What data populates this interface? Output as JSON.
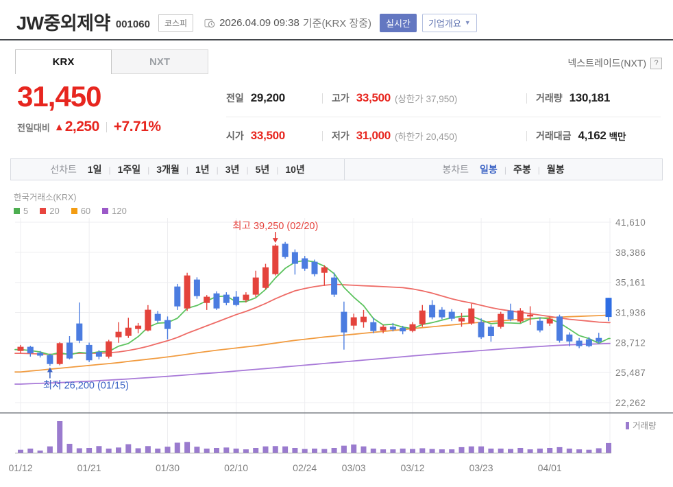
{
  "header": {
    "title": "JW중외제약",
    "code": "001060",
    "market_badge": "코스피",
    "datetime": "2026.04.09 09:38",
    "datetime_suffix": "기준(KRX 장중)",
    "realtime_badge": "실시간",
    "company_overview": "기업개요",
    "nxt_label": "넥스트레이드(NXT)",
    "help": "?"
  },
  "tabs": {
    "krx": "KRX",
    "nxt": "NXT"
  },
  "price": {
    "current": "31,450",
    "change_label": "전일대비",
    "arrow": "▲",
    "change": "2,250",
    "percent": "+7.71%"
  },
  "info": {
    "rows": [
      {
        "cells": [
          {
            "label": "전일",
            "value": "29,200",
            "color": "dark"
          },
          {
            "label": "고가",
            "value": "33,500",
            "color": "red",
            "extra": "(상한가 37,950)"
          },
          {
            "label": "거래량",
            "value": "130,181",
            "color": "dark"
          }
        ]
      },
      {
        "cells": [
          {
            "label": "시가",
            "value": "33,500",
            "color": "red"
          },
          {
            "label": "저가",
            "value": "31,000",
            "color": "red",
            "extra": "(하한가 20,450)"
          },
          {
            "label": "거래대금",
            "value": "4,162",
            "color": "dark",
            "unit": "백만"
          }
        ]
      }
    ]
  },
  "toolbar": {
    "line_label": "선차트",
    "ranges": [
      "1일",
      "1주일",
      "3개월",
      "1년",
      "3년",
      "5년",
      "10년"
    ],
    "candle_label": "봉차트",
    "candle_types": [
      "일봉",
      "주봉",
      "월봉"
    ],
    "selected_candle": "일봉"
  },
  "chart_data": {
    "type": "candlestick+volume",
    "source_label": "한국거래소(KRX)",
    "ma_legend": [
      {
        "period": "5",
        "color": "#4cae50"
      },
      {
        "period": "20",
        "color": "#e8453e"
      },
      {
        "period": "60",
        "color": "#f39c12"
      },
      {
        "period": "120",
        "color": "#9b59c8"
      }
    ],
    "y_ticks": [
      {
        "v": 41610,
        "label": "41,610"
      },
      {
        "v": 38386,
        "label": "38,386"
      },
      {
        "v": 35161,
        "label": "35,161"
      },
      {
        "v": 31936,
        "label": "31,936"
      },
      {
        "v": 28712,
        "label": "28,712"
      },
      {
        "v": 25487,
        "label": "25,487"
      },
      {
        "v": 22262,
        "label": "22,262"
      }
    ],
    "x_ticks": [
      {
        "label": "01/12",
        "index": 0
      },
      {
        "label": "01/21",
        "index": 7
      },
      {
        "label": "01/30",
        "index": 15
      },
      {
        "label": "02/10",
        "index": 22
      },
      {
        "label": "02/24",
        "index": 29
      },
      {
        "label": "03/03",
        "index": 34
      },
      {
        "label": "03/12",
        "index": 40
      },
      {
        "label": "03/23",
        "index": 47
      },
      {
        "label": "04/01",
        "index": 54
      }
    ],
    "annotations": {
      "high": {
        "text": "최고 39,250 (02/20)",
        "index": 26,
        "value": 39250,
        "color": "#e5413c"
      },
      "low": {
        "text": "최저 26,200 (01/15)",
        "index": 3,
        "value": 26200,
        "color": "#3a62c4"
      }
    },
    "volume_legend": "거래량",
    "current_index": 60,
    "colors": {
      "up": "#e4433c",
      "down": "#4b7ce0",
      "current": "#2e6de3",
      "volume": "#9a7bce",
      "grid": "#ededf0",
      "axis_text": "#7f7f7f",
      "ma5": "#5cc35e",
      "ma20": "#ee6b66",
      "ma60": "#f19b3f",
      "ma120": "#a879d8"
    },
    "candles": [
      [
        27800,
        28450,
        27550,
        28250
      ],
      [
        28250,
        28350,
        27200,
        27550
      ],
      [
        27600,
        27800,
        27100,
        27300
      ],
      [
        27350,
        27500,
        26200,
        26400
      ],
      [
        26400,
        28750,
        26270,
        28640
      ],
      [
        28700,
        29400,
        26900,
        27000
      ],
      [
        30750,
        33000,
        28650,
        28900
      ],
      [
        28450,
        28700,
        26600,
        26800
      ],
      [
        27700,
        27900,
        26900,
        27200
      ],
      [
        27200,
        29000,
        27000,
        28830
      ],
      [
        29270,
        30890,
        28680,
        29860
      ],
      [
        29420,
        31360,
        29200,
        30300
      ],
      [
        30150,
        30800,
        29700,
        30520
      ],
      [
        30000,
        32720,
        29900,
        32220
      ],
      [
        31780,
        32100,
        30800,
        31040
      ],
      [
        31110,
        31500,
        29050,
        30160
      ],
      [
        34720,
        35000,
        32200,
        32585
      ],
      [
        32360,
        36190,
        32100,
        35900
      ],
      [
        35460,
        35700,
        33400,
        33690
      ],
      [
        32950,
        33800,
        32200,
        33620
      ],
      [
        33980,
        34200,
        32200,
        32360
      ],
      [
        33840,
        34100,
        32700,
        32950
      ],
      [
        33620,
        34240,
        32600,
        32730
      ],
      [
        33250,
        34100,
        33000,
        33840
      ],
      [
        33840,
        36410,
        33600,
        35680
      ],
      [
        34570,
        37150,
        34400,
        36780
      ],
      [
        36040,
        39250,
        35900,
        39100
      ],
      [
        39300,
        39500,
        37700,
        37880
      ],
      [
        38400,
        38700,
        36000,
        37150
      ],
      [
        37740,
        38000,
        36400,
        36630
      ],
      [
        37370,
        37600,
        35800,
        36040
      ],
      [
        36190,
        37000,
        34790,
        36780
      ],
      [
        35680,
        36200,
        33600,
        33840
      ],
      [
        32000,
        33100,
        27950,
        29790
      ],
      [
        30520,
        31800,
        30100,
        31410
      ],
      [
        30890,
        32200,
        30300,
        31480
      ],
      [
        30890,
        31400,
        29700,
        29940
      ],
      [
        30000,
        30600,
        29700,
        30400
      ],
      [
        30400,
        30800,
        29900,
        30100
      ],
      [
        30300,
        30500,
        29600,
        29900
      ],
      [
        29950,
        30900,
        29800,
        30670
      ],
      [
        30670,
        32730,
        30400,
        32140
      ],
      [
        32730,
        33250,
        31200,
        31410
      ],
      [
        32220,
        32500,
        31200,
        31410
      ],
      [
        32000,
        32300,
        31000,
        31260
      ],
      [
        30970,
        31900,
        30400,
        31330
      ],
      [
        30750,
        32880,
        30600,
        32360
      ],
      [
        30890,
        31300,
        29100,
        29270
      ],
      [
        30400,
        30600,
        28800,
        29400
      ],
      [
        30380,
        32000,
        30200,
        31780
      ],
      [
        32140,
        32880,
        31000,
        31190
      ],
      [
        30970,
        32400,
        30800,
        32140
      ],
      [
        31500,
        32600,
        30600,
        31700
      ],
      [
        31040,
        31400,
        29800,
        30010
      ],
      [
        30750,
        31500,
        30500,
        31260
      ],
      [
        31500,
        31700,
        28700,
        28900
      ],
      [
        29570,
        29800,
        28300,
        28830
      ],
      [
        28910,
        29200,
        28100,
        28320
      ],
      [
        29050,
        29300,
        28200,
        28320
      ],
      [
        29200,
        29750,
        28600,
        28800
      ],
      [
        33500,
        33500,
        31000,
        31450
      ]
    ],
    "volumes": [
      40,
      55,
      30,
      85,
      425,
      120,
      60,
      65,
      90,
      55,
      70,
      115,
      60,
      90,
      55,
      80,
      135,
      145,
      80,
      55,
      65,
      70,
      55,
      45,
      65,
      85,
      90,
      85,
      65,
      50,
      55,
      50,
      65,
      95,
      110,
      85,
      55,
      45,
      45,
      55,
      50,
      60,
      50,
      45,
      45,
      75,
      85,
      85,
      55,
      55,
      50,
      65,
      45,
      55,
      65,
      75,
      55,
      45,
      40,
      60,
      130
    ],
    "ma": {
      "5": [
        27950,
        27850,
        27700,
        27400,
        27630,
        27380,
        27650,
        27550,
        27710,
        27750,
        28320,
        28600,
        29340,
        30350,
        30790,
        30850,
        31310,
        32380,
        32680,
        33190,
        33630,
        33700,
        33070,
        33100,
        33510,
        34400,
        35630,
        36660,
        37320,
        37510,
        37360,
        36900,
        36090,
        34620,
        33570,
        32660,
        31290,
        30600,
        30670,
        30360,
        30200,
        30640,
        30840,
        31110,
        31380,
        31510,
        31550,
        31130,
        30720,
        30830,
        30800,
        30760,
        31240,
        31360,
        31260,
        30800,
        30140,
        29460,
        29130,
        28630,
        29140
      ],
      "20": [
        27550,
        27520,
        27480,
        27450,
        27480,
        27500,
        27560,
        27560,
        27560,
        27600,
        27700,
        27850,
        28050,
        28300,
        28600,
        28900,
        29250,
        29700,
        30100,
        30500,
        30900,
        31300,
        31700,
        32050,
        32450,
        32900,
        33400,
        33850,
        34250,
        34500,
        34700,
        34850,
        34950,
        34900,
        34850,
        34800,
        34750,
        34700,
        34650,
        34600,
        34450,
        34250,
        34000,
        33700,
        33400,
        33150,
        32950,
        32700,
        32450,
        32250,
        32100,
        31950,
        31800,
        31650,
        31500,
        31350,
        31200,
        31100,
        31000,
        30900,
        30850
      ],
      "60": [
        25550,
        25650,
        25750,
        25850,
        25950,
        26050,
        26150,
        26250,
        26350,
        26450,
        26550,
        26680,
        26800,
        26920,
        27040,
        27160,
        27300,
        27450,
        27600,
        27740,
        27880,
        28000,
        28120,
        28240,
        28360,
        28500,
        28650,
        28800,
        28940,
        29060,
        29180,
        29300,
        29400,
        29500,
        29600,
        29700,
        29800,
        29900,
        30000,
        30100,
        30200,
        30300,
        30400,
        30500,
        30600,
        30700,
        30800,
        30880,
        30960,
        31040,
        31120,
        31200,
        31260,
        31320,
        31380,
        31430,
        31480,
        31520,
        31560,
        31600,
        31650
      ],
      "120": [
        24250,
        24290,
        24330,
        24370,
        24410,
        24460,
        24510,
        24560,
        24620,
        24680,
        24740,
        24800,
        24870,
        24940,
        25010,
        25080,
        25160,
        25240,
        25320,
        25400,
        25480,
        25560,
        25650,
        25740,
        25830,
        25920,
        26010,
        26100,
        26190,
        26280,
        26370,
        26460,
        26550,
        26640,
        26730,
        26820,
        26910,
        27000,
        27090,
        27180,
        27270,
        27360,
        27450,
        27530,
        27610,
        27690,
        27770,
        27850,
        27930,
        28010,
        28080,
        28150,
        28220,
        28290,
        28350,
        28410,
        28460,
        28500,
        28540,
        28570,
        28600
      ]
    }
  }
}
